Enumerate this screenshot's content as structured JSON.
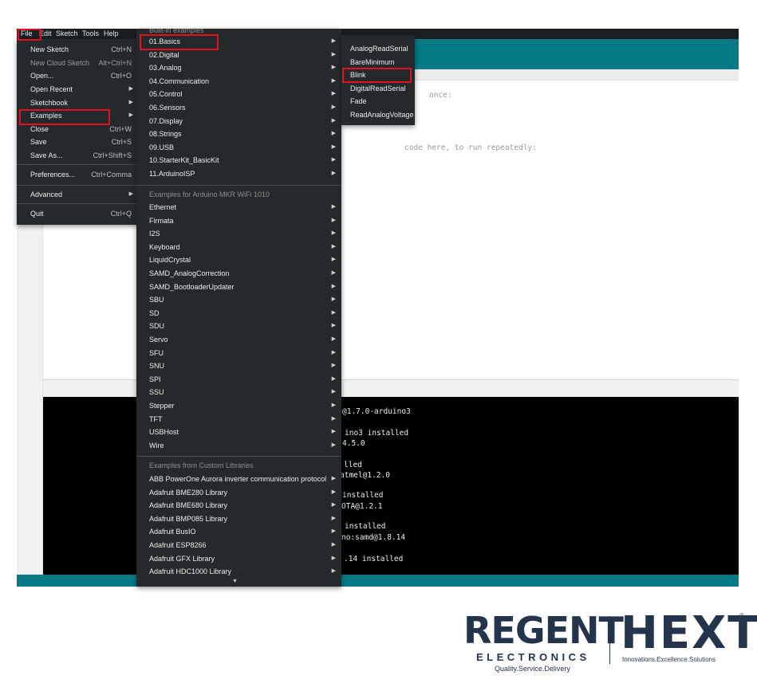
{
  "menubar": [
    "File",
    "Edit",
    "Sketch",
    "Tools",
    "Help"
  ],
  "file_menu": [
    {
      "label": "New Sketch",
      "shortcut": "Ctrl+N"
    },
    {
      "label": "New Cloud Sketch",
      "shortcut": "Alt+Ctrl+N",
      "disabled": true
    },
    {
      "label": "Open...",
      "shortcut": "Ctrl+O"
    },
    {
      "label": "Open Recent",
      "submenu": true
    },
    {
      "label": "Sketchbook",
      "submenu": true
    },
    {
      "label": "Examples",
      "submenu": true
    },
    {
      "label": "Close",
      "shortcut": "Ctrl+W"
    },
    {
      "label": "Save",
      "shortcut": "Ctrl+S"
    },
    {
      "label": "Save As...",
      "shortcut": "Ctrl+Shift+S"
    },
    {
      "label": "Preferences...",
      "shortcut": "Ctrl+Comma"
    },
    {
      "label": "Advanced",
      "submenu": true
    },
    {
      "label": "Quit",
      "shortcut": "Ctrl+Q"
    }
  ],
  "examples_menu": {
    "builtin_header": "Built-in examples",
    "builtin": [
      "01.Basics",
      "02.Digital",
      "03.Analog",
      "04.Communication",
      "05.Control",
      "06.Sensors",
      "07.Display",
      "08.Strings",
      "09.USB",
      "10.StarterKit_BasicKit",
      "11.ArduinoISP"
    ],
    "board_header": "Examples for Arduino MKR WiFi 1010",
    "board": [
      "Ethernet",
      "Firmata",
      "I2S",
      "Keyboard",
      "LiquidCrystal",
      "SAMD_AnalogCorrection",
      "SAMD_BootloaderUpdater",
      "SBU",
      "SD",
      "SDU",
      "Servo",
      "SFU",
      "SNU",
      "SPI",
      "SSU",
      "Stepper",
      "TFT",
      "USBHost",
      "Wire"
    ],
    "custom_header": "Examples from Custom Libraries",
    "custom": [
      "ABB PowerOne Aurora inverter communication protocol",
      "Adafruit BME280 Library",
      "Adafruit BME680 Library",
      "Adafruit BMP085 Library",
      "Adafruit BusIO",
      "Adafruit ESP8266",
      "Adafruit GFX Library",
      "Adafruit HDC1000 Library"
    ]
  },
  "basics_menu": [
    "AnalogReadSerial",
    "BareMinimum",
    "Blink",
    "DigitalReadSerial",
    "Fade",
    "ReadAnalogVoltage"
  ],
  "editor": {
    "visible_fragments": [
      "once:",
      "code here, to run repeatedly:"
    ]
  },
  "console": {
    "lines": [
      "@1.7.0-arduino3",
      "ino3 installed",
      "4.5.0",
      "lled",
      "atmel@1.2.0",
      "installed",
      "OTA@1.2.1",
      "installed",
      "no:samd@1.8.14",
      ".14 installed"
    ]
  },
  "logo": {
    "brand1": "REGENT",
    "brand1_sub": "ELECTRONICS",
    "brand1_tagline": "Quality.Service.Delivery",
    "brand2": "HEXT",
    "brand2_tagline": "Innovations.Excellence.Solutions",
    "registered": "®"
  },
  "colors": {
    "accent_teal": "#037a85",
    "menu_bg": "#26292b",
    "highlight_red": "#e0121b",
    "logo_navy": "#24344d"
  },
  "icons": [
    "user-avatar-icon",
    "submenu-arrow-icon",
    "scroll-down-arrow-icon"
  ]
}
